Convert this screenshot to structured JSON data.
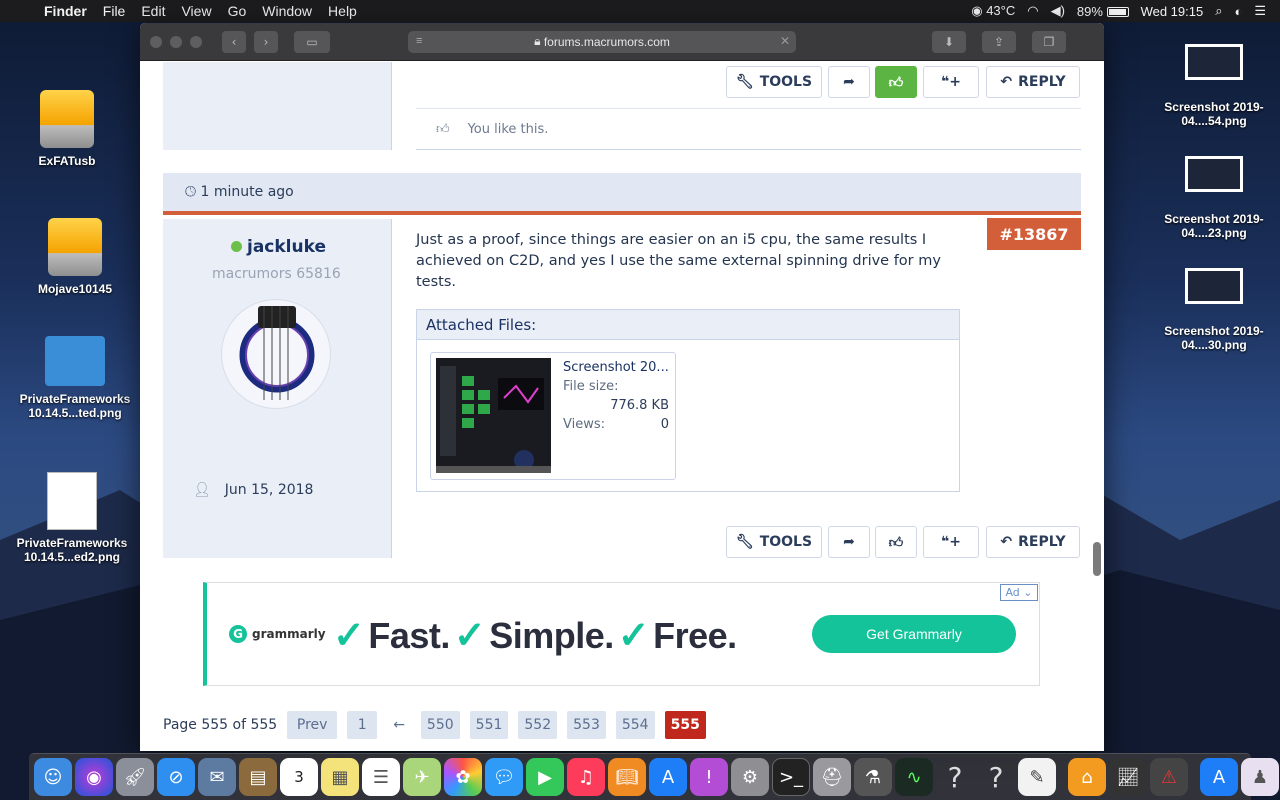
{
  "menubar": {
    "app_name": "Finder",
    "menus": [
      "File",
      "Edit",
      "View",
      "Go",
      "Window",
      "Help"
    ],
    "temperature": "43°C",
    "battery": "89%",
    "clock": "Wed 19:15"
  },
  "desktop": {
    "icons_left": [
      {
        "label": "ExFATusb"
      },
      {
        "label": "Mojave10145"
      },
      {
        "label": "PrivateFrameworks 10.14.5...ted.png"
      },
      {
        "label": "PrivateFrameworks 10.14.5...ed2.png"
      }
    ],
    "icons_right": [
      {
        "label": "Screenshot 2019-04....54.png"
      },
      {
        "label": "Screenshot 2019-04....23.png"
      },
      {
        "label": "Screenshot 2019-04....30.png"
      }
    ]
  },
  "browser": {
    "url": "forums.macrumors.com"
  },
  "previous_post": {
    "buttons": {
      "tools": "TOOLS",
      "reply": "REPLY"
    },
    "likes_text": "You like this."
  },
  "post": {
    "time": "1 minute ago",
    "number": "#13867",
    "username": "jackluke",
    "user_title": "macrumors 65816",
    "join_date": "Jun 15, 2018",
    "body": "Just as a proof, since things are easier on an i5 cpu, the same results I achieved on C2D, and yes I use the same external spinning drive for my tests.",
    "attachments_header": "Attached Files:",
    "attachment": {
      "filename": "Screenshot 20...",
      "file_size_label": "File size:",
      "file_size": "776.8 KB",
      "views_label": "Views:",
      "views": "0"
    },
    "buttons": {
      "tools": "TOOLS",
      "reply": "REPLY"
    }
  },
  "ad": {
    "tag": "Ad",
    "brand": "grammarly",
    "slogan": [
      "Fast.",
      "Simple.",
      "Free."
    ],
    "cta": "Get Grammarly"
  },
  "pagination": {
    "label": "Page 555 of 555",
    "prev": "Prev",
    "first": "1",
    "ellipsis_arrow": "←",
    "pages": [
      "550",
      "551",
      "552",
      "553",
      "554"
    ],
    "current": "555"
  },
  "colors": {
    "accent_orange": "#d35f3a",
    "like_green": "#5cb543",
    "current_page_red": "#c0281e",
    "grammarly_green": "#15c39a"
  }
}
